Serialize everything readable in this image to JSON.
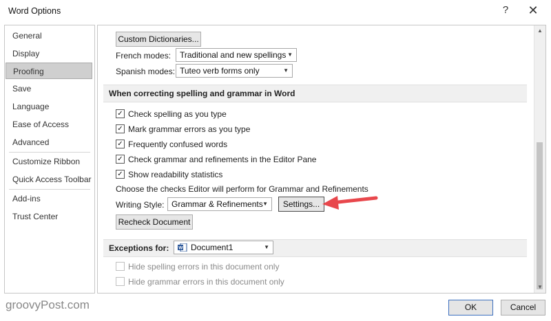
{
  "window": {
    "title": "Word Options",
    "help_glyph": "?",
    "close_glyph": "✕"
  },
  "sidebar": {
    "items": [
      {
        "label": "General"
      },
      {
        "label": "Display"
      },
      {
        "label": "Proofing"
      },
      {
        "label": "Save"
      },
      {
        "label": "Language"
      },
      {
        "label": "Ease of Access"
      },
      {
        "label": "Advanced"
      },
      {
        "label": "Customize Ribbon"
      },
      {
        "label": "Quick Access Toolbar"
      },
      {
        "label": "Add-ins"
      },
      {
        "label": "Trust Center"
      }
    ],
    "active": "Proofing"
  },
  "dictionary": {
    "custom_button": "Custom Dictionaries...",
    "french_label": "French modes:",
    "french_value": "Traditional and new spellings",
    "spanish_label": "Spanish modes:",
    "spanish_value": "Tuteo verb forms only"
  },
  "correcting": {
    "title": "When correcting spelling and grammar in Word",
    "options": [
      {
        "label": "Check spelling as you type",
        "checked": true
      },
      {
        "label": "Mark grammar errors as you type",
        "checked": true
      },
      {
        "label": "Frequently confused words",
        "checked": true
      },
      {
        "label": "Check grammar and refinements in the Editor Pane",
        "checked": true
      },
      {
        "label": "Show readability statistics",
        "checked": true
      }
    ],
    "checkmark": "✓",
    "editor_note": "Choose the checks Editor will perform for Grammar and Refinements",
    "writing_style_label": "Writing Style:",
    "writing_style_value": "Grammar & Refinements",
    "settings_button": "Settings...",
    "recheck_button": "Recheck Document"
  },
  "exceptions": {
    "label": "Exceptions for:",
    "document": "Document1",
    "options": [
      {
        "label": "Hide spelling errors in this document only",
        "checked": false
      },
      {
        "label": "Hide grammar errors in this document only",
        "checked": false
      }
    ]
  },
  "footer": {
    "watermark": "groovyPost.com",
    "ok": "OK",
    "cancel": "Cancel"
  },
  "colors": {
    "annotation_arrow": "#e8474c",
    "ok_border": "#3c6fbf"
  }
}
